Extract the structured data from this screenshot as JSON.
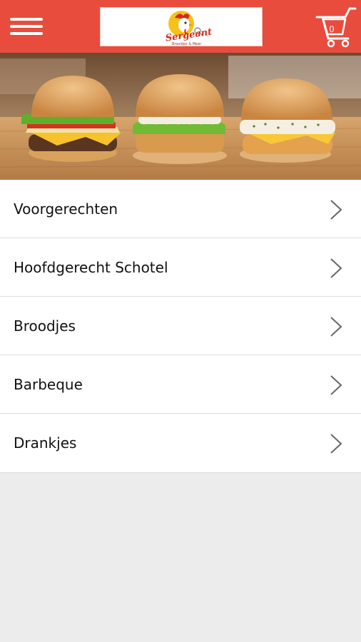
{
  "header": {
    "menu_icon": "hamburger-menu-icon",
    "logo_text": "Sergeant",
    "logo_tagline": "Broodjes & Meer",
    "cart_icon": "shopping-cart-icon",
    "cart_count": "0",
    "background_color": "#e84c3d"
  },
  "hero": {
    "image": "three-burgers-banner"
  },
  "menu": {
    "chevron_icon": "chevron-right-icon",
    "items": [
      {
        "label": "Voorgerechten"
      },
      {
        "label": "Hoofdgerecht Schotel"
      },
      {
        "label": "Broodjes"
      },
      {
        "label": "Barbeque"
      },
      {
        "label": "Drankjes"
      }
    ]
  }
}
